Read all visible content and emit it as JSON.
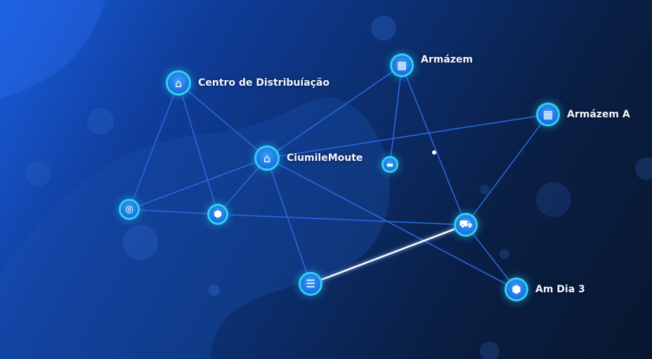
{
  "nodes": [
    {
      "id": "cd",
      "label": "Centro de Distribuíação",
      "icon": "house-icon"
    },
    {
      "id": "hub",
      "label": "CiumileMoute",
      "icon": "house-icon"
    },
    {
      "id": "arm",
      "label": "Armázem",
      "icon": "warehouse-icon"
    },
    {
      "id": "armA",
      "label": "Armázem A",
      "icon": "warehouse-icon"
    },
    {
      "id": "small",
      "label": "",
      "icon": "box-icon"
    },
    {
      "id": "left",
      "label": "",
      "icon": "support-icon"
    },
    {
      "id": "box",
      "label": "",
      "icon": "cube-icon"
    },
    {
      "id": "truck",
      "label": "",
      "icon": "truck-icon"
    },
    {
      "id": "list",
      "label": "",
      "icon": "list-icon"
    },
    {
      "id": "dia3",
      "label": "Am Dia 3",
      "icon": "cube-icon"
    }
  ],
  "edges": [
    [
      "cd",
      "left"
    ],
    [
      "cd",
      "box"
    ],
    [
      "cd",
      "hub"
    ],
    [
      "hub",
      "arm"
    ],
    [
      "hub",
      "armA"
    ],
    [
      "hub",
      "left"
    ],
    [
      "hub",
      "box"
    ],
    [
      "hub",
      "list"
    ],
    [
      "hub",
      "dia3"
    ],
    [
      "arm",
      "small"
    ],
    [
      "arm",
      "truck"
    ],
    [
      "armA",
      "truck"
    ],
    [
      "left",
      "box"
    ],
    [
      "box",
      "truck"
    ],
    [
      "truck",
      "dia3"
    ],
    [
      "list",
      "truck"
    ]
  ],
  "highlighted_edge": [
    "list",
    "truck"
  ],
  "colors": {
    "edge": "#2a66e0",
    "highlight": "#ffffff",
    "node_ring": "#2fd0f0"
  }
}
